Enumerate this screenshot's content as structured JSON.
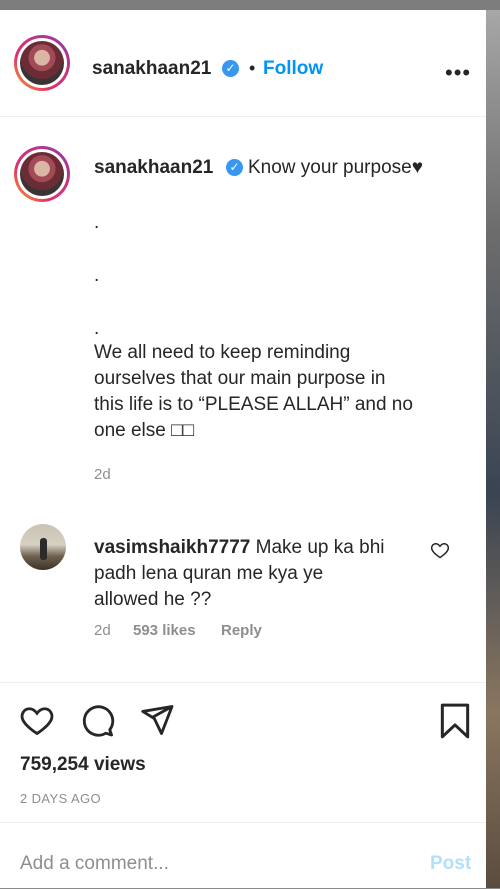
{
  "header": {
    "username": "sanakhaan21",
    "separator": "•",
    "follow_label": "Follow",
    "more_label": "•••"
  },
  "caption": {
    "username": "sanakhaan21",
    "first_line": "Know your purpose♥",
    "dot1": ".",
    "dot2": ".",
    "dot3": ".",
    "lines": [
      "We all need to keep reminding",
      "ourselves that our main purpose in",
      "this life is to “PLEASE ALLAH” and no",
      "one else □□"
    ],
    "time": "2d"
  },
  "comment": {
    "username": "vasimshaikh7777",
    "line1": "Make up ka bhi",
    "line2": "padh lena quran me kya ye",
    "line3": "allowed he ??",
    "time": "2d",
    "likes": "593 likes",
    "reply": "Reply"
  },
  "actions": {
    "like_icon": "heart-icon",
    "comment_icon": "comment-icon",
    "share_icon": "paper-plane-icon",
    "save_icon": "bookmark-icon"
  },
  "stats": {
    "views": "759,254 views",
    "posted": "2 DAYS AGO"
  },
  "add_comment": {
    "placeholder": "Add a comment...",
    "post_label": "Post"
  },
  "colors": {
    "link": "#0095f6",
    "verified": "#3897f0",
    "muted": "#8e8e8e",
    "post_disabled": "#b2dffc"
  }
}
